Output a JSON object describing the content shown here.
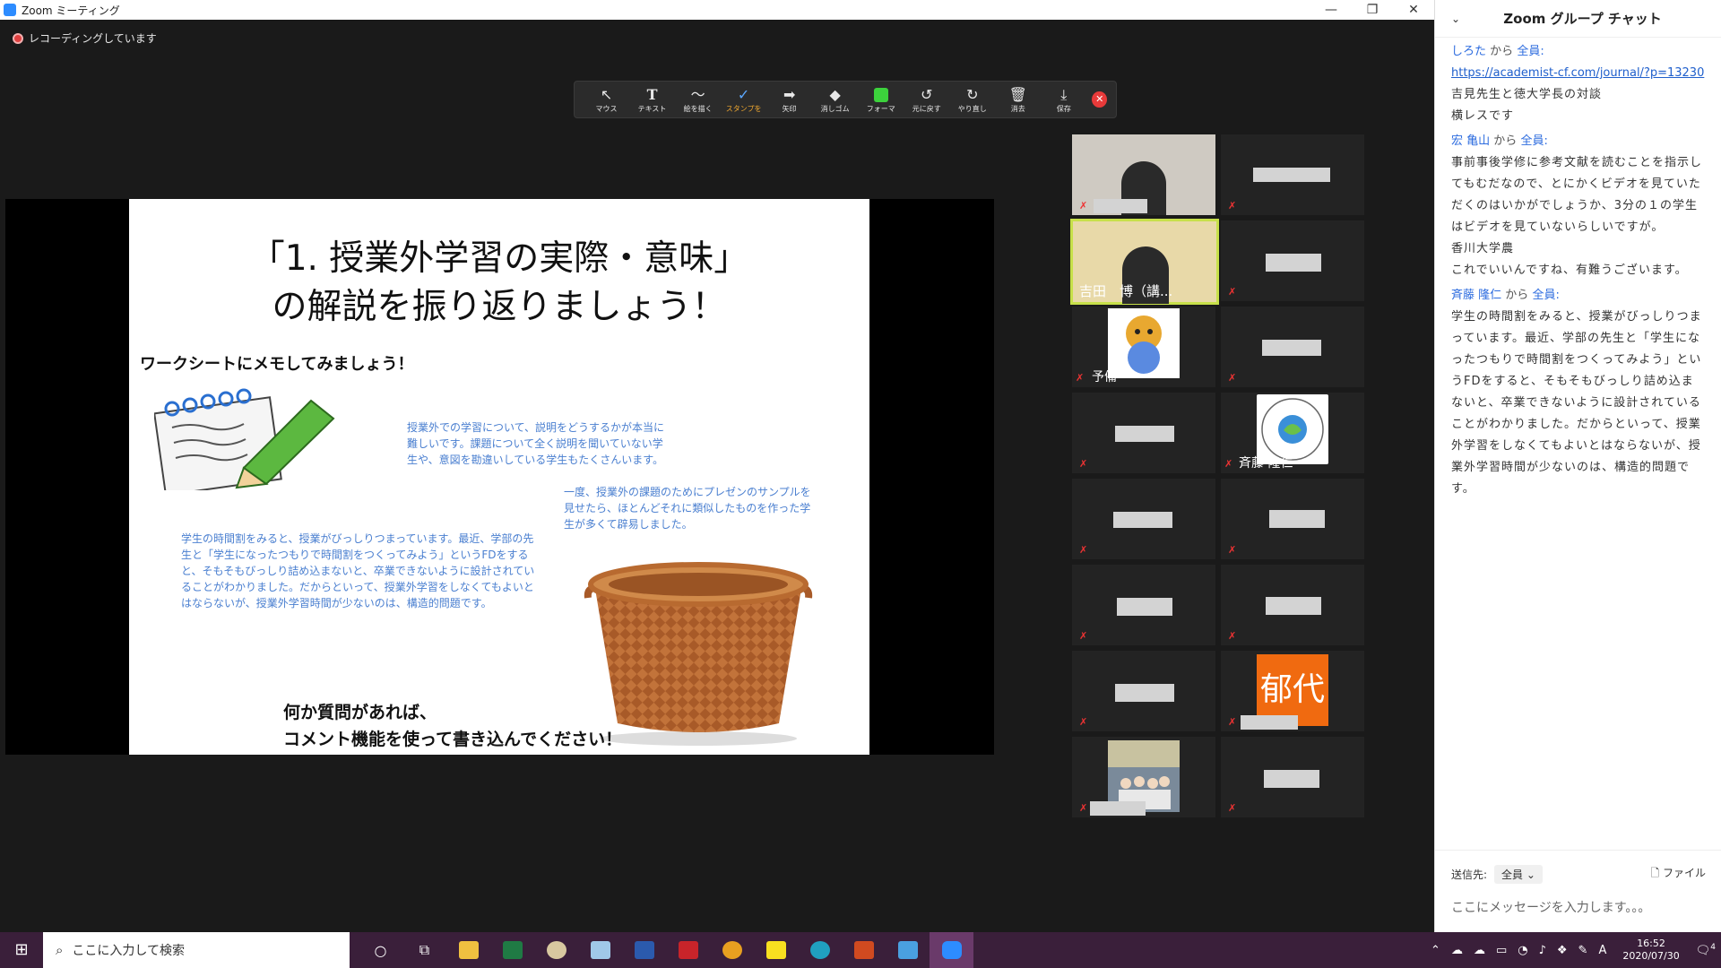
{
  "window": {
    "title": "Zoom ミーティング",
    "min": "—",
    "restore": "❐",
    "close": "✕"
  },
  "recording": {
    "label": "レコーディングしています"
  },
  "annotate": {
    "tools": [
      {
        "label": "マウス",
        "icon": "↖"
      },
      {
        "label": "テキスト",
        "icon": "T"
      },
      {
        "label": "絵を描く",
        "icon": "〜"
      },
      {
        "label": "スタンプを",
        "icon": "✓"
      },
      {
        "label": "矢印",
        "icon": "➡"
      },
      {
        "label": "消しゴム",
        "icon": "◆"
      },
      {
        "label": "フォーマ",
        "icon": ""
      },
      {
        "label": "元に戻す",
        "icon": "↺"
      },
      {
        "label": "やり直し",
        "icon": "↻"
      },
      {
        "label": "消去",
        "icon": "🗑"
      },
      {
        "label": "保存",
        "icon": "⤓"
      }
    ],
    "close": "✕"
  },
  "slide": {
    "title_line1": "「1. 授業外学習の実際・意味」",
    "title_line2": "の解説を振り返りましょう！",
    "worksheet": "ワークシートにメモしてみましょう！",
    "note1": "授業外での学習について、説明をどうするかが本当に難しいです。課題について全く説明を聞いていない学生や、意図を勘違いしている学生もたくさんいます。",
    "note2": "一度、授業外の課題のためにプレゼンのサンプルを見せたら、ほとんどそれに類似したものを作った学生が多くて辟易しました。",
    "note3": "学生の時間割をみると、授業がびっしりつまっています。最近、学部の先生と「学生になったつもりで時間割をつくってみよう」というFDをすると、そもそもびっしり詰め込まないと、卒業できないように設計されていることがわかりました。だからといって、授業外学習をしなくてもよいとはならないが、授業外学習時間が少ないのは、構造的問題です。",
    "question1": "何か質問があれば、",
    "question2": "コメント機能を使って書き込んでください！"
  },
  "gallery": {
    "names": {
      "yoshida": "吉田　博（講...",
      "yobi": "予備",
      "saito": "斉藤 隆仁",
      "ikuyo": "郁代"
    }
  },
  "chat": {
    "title": "Zoom グループ チャット",
    "messages": [
      {
        "sender": "しろた",
        "from": "から",
        "to": "全員:",
        "link": "https://academist-cf.com/journal/?p=13230",
        "lines": [
          "吉見先生と徳大学長の対談",
          "横レスです"
        ]
      },
      {
        "sender": "宏 亀山",
        "from": "から",
        "to": "全員:",
        "lines": [
          "事前事後学修に参考文献を読むことを指示してもむだなので、とにかくビデオを見ていただくのはいかがでしょうか、3分の１の学生はビデオを見ていないらしいですが。",
          "香川大学農",
          "これでいいんですね、有難うございます。"
        ]
      },
      {
        "sender": "斉藤 隆仁",
        "from": "から",
        "to": "全員:",
        "lines": [
          "学生の時間割をみると、授業がびっしりつまっています。最近、学部の先生と「学生になったつもりで時間割をつくってみよう」というFDをすると、そもそもびっしり詰め込まないと、卒業できないように設計されていることがわかりました。だからといって、授業外学習をしなくてもよいとはならないが、授業外学習時間が少ないのは、構造的問題です。"
        ]
      }
    ],
    "to_label": "送信先:",
    "to_value": "全員 ⌄",
    "file": "ファイル",
    "placeholder": "ここにメッセージを入力します。。。"
  },
  "taskbar": {
    "search": "ここに入力して検索",
    "time": "16:52",
    "date": "2020/07/30",
    "notif": "4",
    "ime": "A"
  }
}
